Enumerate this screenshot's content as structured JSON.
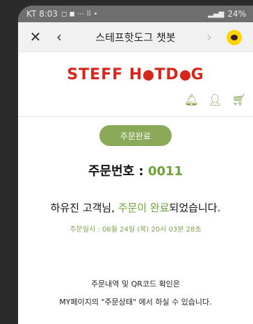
{
  "status": {
    "carrier_time": "KT 8:03",
    "left_icons": "◻ ◼ ⋯ ⠿ •",
    "right_info": "24%"
  },
  "nav": {
    "close": "✕",
    "back": "‹",
    "title": "스테프핫도그 챗봇",
    "forward": "›"
  },
  "brand": {
    "logo_part1": "STEFF H",
    "logo_part2": "TD",
    "logo_part3": "G"
  },
  "icons": [
    "bell-icon",
    "user-icon",
    "cart-icon"
  ],
  "order": {
    "status_pill": "주문완료",
    "number_label": "주문번호 : ",
    "number_value": "0011",
    "msg_prefix": "하유진 고객님, ",
    "msg_highlight": "주문이 완료",
    "msg_suffix": "되었습니다.",
    "datetime": "주문일시 : 06월 24일 (목) 20시 03분 28초"
  },
  "info": {
    "line1": "주문내역 및 QR코드 확인은",
    "line2": "MY페이지의 \"주문상태\" 에서 하실 수 있습니다."
  },
  "colors": {
    "accent_green": "#6da336",
    "pill_bg": "#8aaa5a",
    "brand_red": "#d7261c",
    "kakao_yellow": "#ffd400"
  }
}
